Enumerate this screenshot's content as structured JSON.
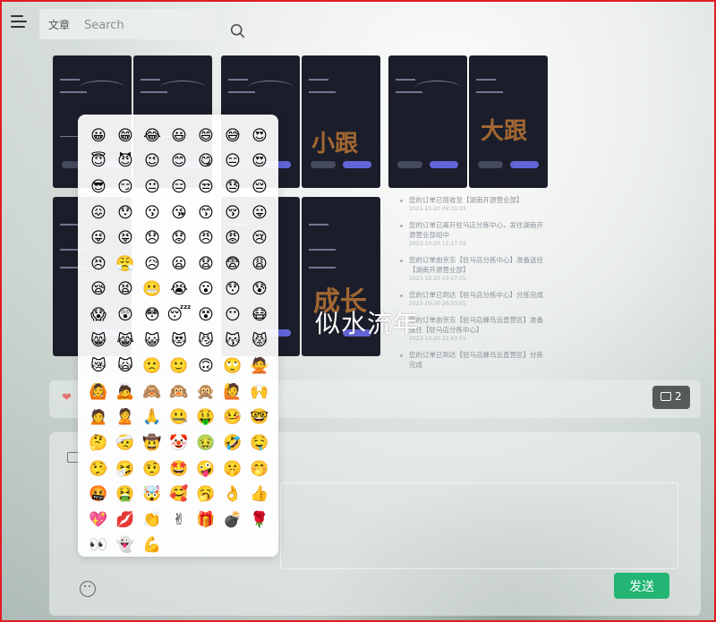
{
  "header": {
    "search_prefix": "文章",
    "search_placeholder": "Search",
    "menu_icon": "hamburger-icon",
    "search_icon": "search-icon"
  },
  "handwriting": [
    "小跟",
    "大跟",
    "成长"
  ],
  "timeline": [
    {
      "text": "您的订单已揽收至【湖南开源营业部】",
      "time": "2023-10-20 09:33:03"
    },
    {
      "text": "您的订单已离开驻马店分拣中心，发往湖南开源营业部组中",
      "time": "2023-10-20 12:17:59"
    },
    {
      "text": "您的订单由京东【驻马店分拣中心】准备送往【湖南开源营业部】",
      "time": "2023-10-20 13:17:55"
    },
    {
      "text": "您的订单已到达【驻马店分拣中心】分拣完成",
      "time": "2023-10-20 20:33:55"
    },
    {
      "text": "您的订单由京东【驻马店蜂鸟云直营区】准备送往【驻马店分拣中心】",
      "time": "2023-10-20 21:43:55"
    },
    {
      "text": "您的订单已到达【驻马店蜂鸟云直营区】分拣完成",
      "time": ""
    }
  ],
  "watermark": "似水流年",
  "reactions": {
    "heart_icon": "heart-icon",
    "comment_count": "2"
  },
  "comment": {
    "send_label": "发送"
  },
  "emoji_grid": [
    "😀",
    "😁",
    "😂",
    "😃",
    "😄",
    "😅",
    "😍",
    "😇",
    "😈",
    "😉",
    "😊",
    "😋",
    "😑",
    "😍",
    "😎",
    "😏",
    "😐",
    "😑",
    "😒",
    "😓",
    "😔",
    "😖",
    "😯",
    "😗",
    "😘",
    "😙",
    "😚",
    "😛",
    "😜",
    "😝",
    "😞",
    "😟",
    "😠",
    "😡",
    "😢",
    "😣",
    "😤",
    "😥",
    "😦",
    "😧",
    "😨",
    "😩",
    "😪",
    "😫",
    "😬",
    "😭",
    "😮",
    "😯",
    "😰",
    "😱",
    "😲",
    "😳",
    "😴",
    "😵",
    "😶",
    "😷",
    "😸",
    "😹",
    "😺",
    "😻",
    "😼",
    "😽",
    "😾",
    "😿",
    "🙀",
    "🙁",
    "🙂",
    "🙃",
    "🙄",
    "🙅",
    "🙆",
    "🙇",
    "🙈",
    "🙉",
    "🙊",
    "🙋",
    "🙌",
    "🙍",
    "🙎",
    "🙏",
    "🤐",
    "🤑",
    "🤒",
    "🤓",
    "🤔",
    "🤕",
    "🤠",
    "🤡",
    "🤢",
    "🤣",
    "🤤",
    "🤥",
    "🤧",
    "🤨",
    "🤩",
    "🤪",
    "🤫",
    "🤭",
    "🤬",
    "🤮",
    "🤯",
    "🥰",
    "🥱",
    "👌",
    "👍",
    "💖",
    "💋",
    "👏",
    "✌",
    "🎁",
    "💣",
    "🌹",
    "👀",
    "👻",
    "💪"
  ]
}
